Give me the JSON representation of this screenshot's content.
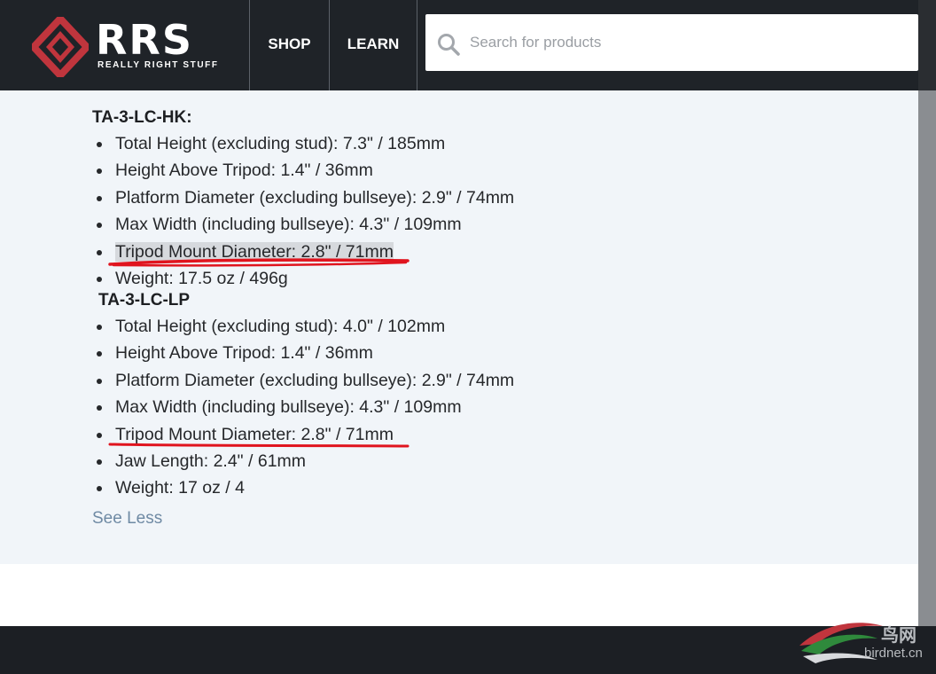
{
  "header": {
    "logo_word": "RRS",
    "logo_sub": "REALLY RIGHT STUFF",
    "nav": [
      {
        "label": "SHOP"
      },
      {
        "label": "LEARN"
      }
    ],
    "search": {
      "placeholder": "Search for products",
      "value": ""
    }
  },
  "specs": {
    "groups": [
      {
        "title": "TA-3-LC-HK:",
        "items": [
          "Total Height (excluding stud): 7.3\" / 185mm",
          "Height Above Tripod: 1.4\" / 36mm",
          "Platform Diameter (excluding bullseye): 2.9\" / 74mm",
          "Max Width (including bullseye): 4.3\" / 109mm",
          "Tripod Mount Diameter: 2.8\" / 71mm",
          "Weight: 17.5 oz / 496g"
        ]
      },
      {
        "title": "TA-3-LC-LP",
        "items": [
          "Total Height (excluding stud): 4.0\" / 102mm",
          "Height Above Tripod: 1.4\" / 36mm",
          "Platform Diameter (excluding bullseye): 2.9\" / 74mm",
          "Max Width (including bullseye): 4.3\" / 109mm",
          "Tripod Mount Diameter: 2.8\" / 71mm",
          "Jaw Length: 2.4\" / 61mm",
          "Weight: 17 oz / 4"
        ]
      }
    ],
    "see_less": "See Less"
  },
  "watermark": {
    "line1": "鸟网",
    "line2": "birdnet.cn"
  },
  "colors": {
    "header_bg": "#1f2328",
    "brand_red": "#c0353d",
    "content_bg": "#f1f5f9",
    "link": "#6f8aa4",
    "annotation_red": "#e0141e"
  }
}
